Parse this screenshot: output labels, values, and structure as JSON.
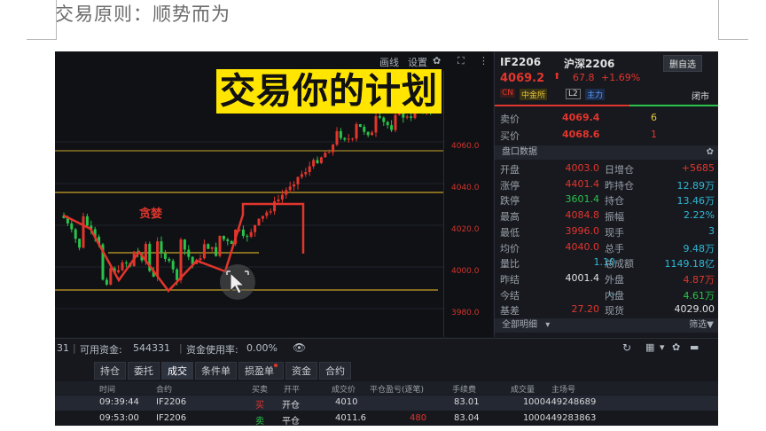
{
  "document": {
    "title": "交易原则：顺势而为"
  },
  "overlay": {
    "title": "交易你的计划",
    "pattern_label": "贪婪"
  },
  "chart": {
    "toolbar": {
      "drawing": "画线",
      "settings": "设置",
      "gear": "✿",
      "fullscreen": "⛶",
      "more": "⋮"
    },
    "price_labels": [
      "4060.0",
      "4040.0",
      "4020.0",
      "4000.0",
      "3980.0"
    ],
    "colors": {
      "up": "#e2352c",
      "down": "#29c24a",
      "level": "#c9a227"
    }
  },
  "quote": {
    "symbol": "IF2206",
    "name": "沪深2206",
    "add_button": "删自选",
    "last_price": "4069.2",
    "change": "67.8",
    "change_pct": "+1.69%",
    "tags": [
      "CN",
      "中金所",
      "L2",
      "主力"
    ],
    "side_tag": "闭市",
    "ask": {
      "label": "卖价",
      "price": "4069.4",
      "vol": "6"
    },
    "bid": {
      "label": "买价",
      "price": "4068.6",
      "vol": "1"
    },
    "section_title": "盘口数据",
    "stats": [
      {
        "l1": "开盘",
        "v1": "4003.0",
        "c1": "red",
        "l2": "日增仓",
        "v2": "+5685",
        "c2": "red"
      },
      {
        "l1": "涨停",
        "v1": "4401.4",
        "c1": "red",
        "l2": "昨持仓",
        "v2": "12.89万",
        "c2": "cyan"
      },
      {
        "l1": "跌停",
        "v1": "3601.4",
        "c1": "green",
        "l2": "持仓",
        "v2": "13.46万",
        "c2": "cyan"
      },
      {
        "l1": "最高",
        "v1": "4084.8",
        "c1": "red",
        "l2": "振幅",
        "v2": "2.22%",
        "c2": "cyan"
      },
      {
        "l1": "最低",
        "v1": "3996.0",
        "c1": "red",
        "l2": "现手",
        "v2": "3",
        "c2": "cyan"
      },
      {
        "l1": "均价",
        "v1": "4040.0",
        "c1": "red",
        "l2": "总手",
        "v2": "9.48万",
        "c2": "cyan"
      },
      {
        "l1": "量比",
        "v1": "1.10",
        "c1": "cyan",
        "l2": "总成额",
        "v2": "1149.18亿",
        "c2": "cyan"
      },
      {
        "l1": "昨结",
        "v1": "4001.4",
        "c1": "white",
        "l2": "外盘",
        "v2": "4.87万",
        "c2": "red"
      },
      {
        "l1": "今结",
        "v1": "--",
        "c1": "cyan",
        "l2": "内盘",
        "v2": "4.61万",
        "c2": "green"
      },
      {
        "l1": "基差",
        "v1": "27.20",
        "c1": "red",
        "l2": "现货",
        "v2": "4029.00",
        "c2": "white"
      }
    ],
    "detail_section": "全部明细",
    "filter": "筛选"
  },
  "bottom": {
    "account_prefix": "31",
    "available_label": "可用资金:",
    "available_value": "544331",
    "usage_label": "资金使用率:",
    "usage_value": "0.00%",
    "tabs": [
      "持仓",
      "委托",
      "成交",
      "条件单",
      "损盈单",
      "资金",
      "合约"
    ],
    "active_tab": 2,
    "columns": [
      "时间",
      "合约",
      "买卖",
      "开平",
      "成交价",
      "平仓盈亏(逐笔)",
      "手续费",
      "成交量",
      "主场号"
    ],
    "rows": [
      {
        "time": "09:39:44",
        "contract": "IF2206",
        "side": "买",
        "oc": "开仓",
        "price": "4010",
        "pnl": "",
        "fee": "83.01",
        "qty": "1",
        "id": "000449248689"
      },
      {
        "time": "09:53:00",
        "contract": "IF2206",
        "side": "卖",
        "oc": "平仓",
        "price": "4011.6",
        "pnl": "480",
        "fee": "83.04",
        "qty": "1",
        "id": "000449283863"
      }
    ]
  }
}
